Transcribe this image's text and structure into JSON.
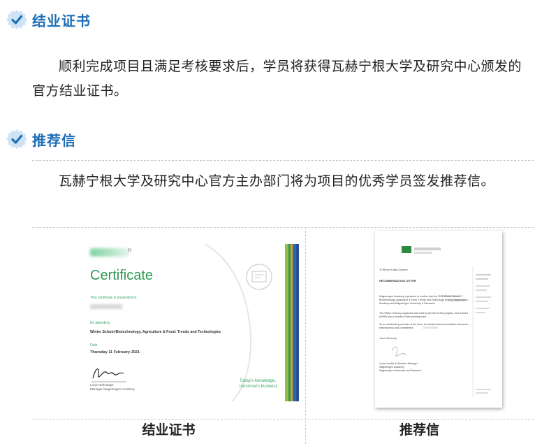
{
  "sections": [
    {
      "title": "结业证书",
      "paragraph": "顺利完成项目且满足考核要求后，学员将获得瓦赫宁根大学及研究中心颁发的官方结业证书。"
    },
    {
      "title": "推荐信",
      "paragraph": "瓦赫宁根大学及研究中心官方主办部门将为项目的优秀学员签发推荐信。"
    }
  ],
  "certificate_image": {
    "logo_letter": "n",
    "title": "Certificate",
    "presented_to": "This certificate is presented to",
    "for_attending": "for attending",
    "course": "Winter School-Biotechnology, Agriculture & Food: Trends and Technologies",
    "date_label": "Date",
    "date": "Thursday 11 February 2021",
    "signer_name": "Louiz Nethologie",
    "signer_role": "Manager Wageningen Academy",
    "tagline_1": "Today's knowledge,",
    "tagline_2": "tomorrow's business",
    "stripe_colors": [
      "#8fc04b",
      "#2b9b56",
      "#e59a2a",
      "#1f6fb5",
      "#2e4f8f"
    ]
  },
  "letter_image": {
    "salutation": "To Whom It May Concern,",
    "heading": "RECOMMENDATION LETTER",
    "body_1": "Wageningen Academy is pleased to confirm that the 2021 Winter School-Biotechnology, Agriculture & Food: Trends and Technology held by Wageningen Academy and Wageningen University & Research",
    "body_2": "The Winter School programme was held by the first of the program, and learned (WUR) has a member of the winning team.",
    "body_3": "As an outstanding member of the team, the student showed excellent teamwork, effectiveness and commitment.",
    "closing": "Yours Sincerely,",
    "sign_1": "Louiz Laurike & Directive Manager",
    "sign_2": "Wageningen Academy",
    "sign_3": "Wageningen University and Research"
  },
  "captions": {
    "certificate": "结业证书",
    "letter": "推荐信"
  },
  "colors": {
    "heading": "#1f6fb5",
    "badge": "#cfe3f6",
    "check": "#1f6fb5",
    "cert_green": "#2f9a52"
  }
}
